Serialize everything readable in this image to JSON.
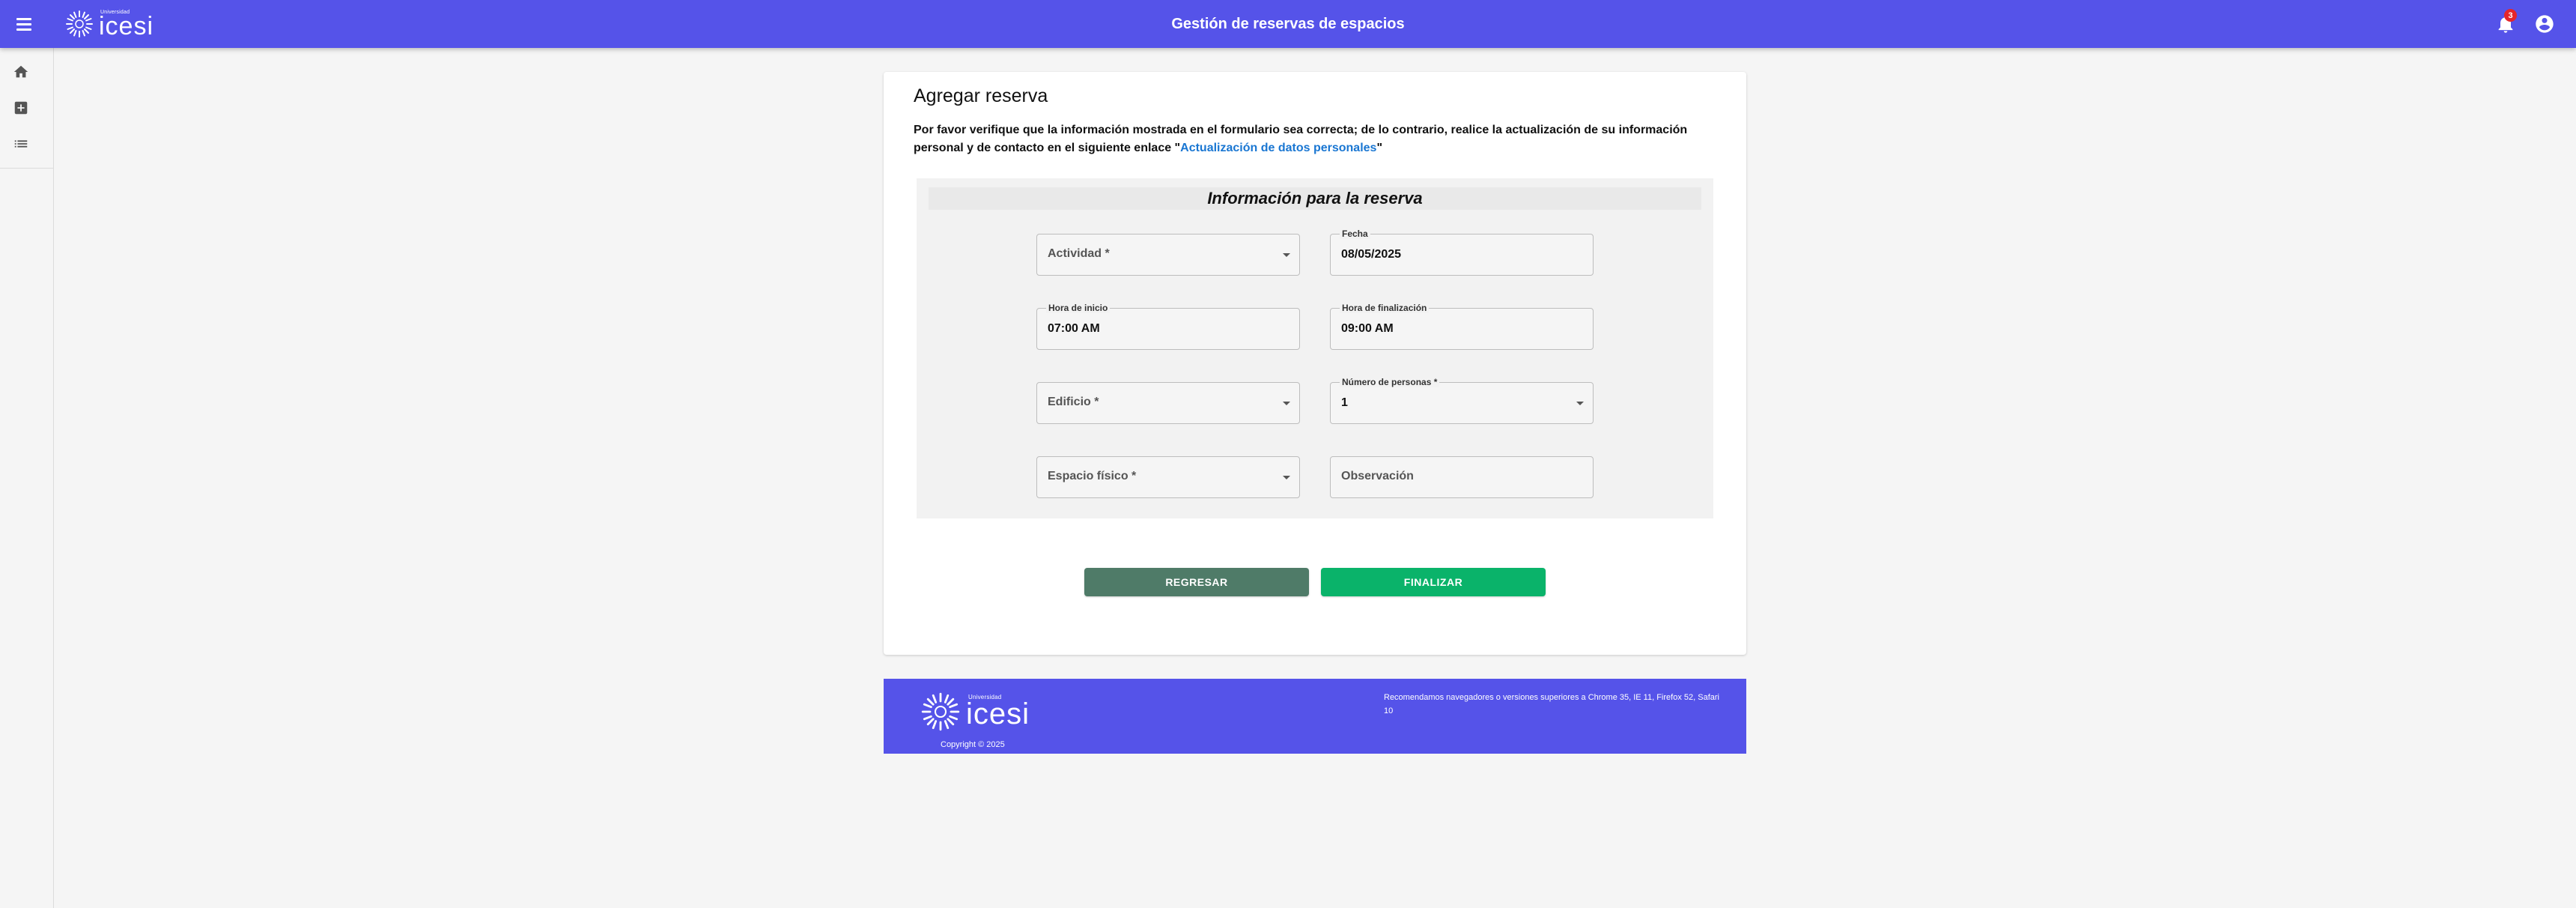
{
  "header": {
    "app_title": "Gestión de reservas de espacios",
    "logo_small": "Universidad",
    "logo_big": "icesi",
    "notification_count": "3",
    "icons": [
      "menu-icon",
      "bell-icon",
      "account-circle-icon"
    ],
    "color": "#5553e9"
  },
  "sidebar": {
    "items": [
      {
        "icon": "home-icon"
      },
      {
        "icon": "add-box-icon"
      },
      {
        "icon": "list-icon"
      }
    ]
  },
  "main": {
    "title": "Agregar reserva",
    "notice_text": "Por favor verifique que la información mostrada en el formulario sea correcta; de lo contrario, realice la actualización de su información personal y de contacto en el siguiente enlace \"",
    "notice_link": "Actualización de datos personales",
    "notice_end": "\"",
    "section_title": "Información para la reserva",
    "fields": {
      "actividad": {
        "placeholder": "Actividad *",
        "value": ""
      },
      "fecha": {
        "label": "Fecha",
        "value": "08/05/2025"
      },
      "hora_inicio": {
        "label": "Hora de inicio",
        "value": "07:00 AM"
      },
      "hora_fin": {
        "label": "Hora de finalización",
        "value": "09:00 AM"
      },
      "edificio": {
        "placeholder": "Edificio *",
        "value": ""
      },
      "numero_personas": {
        "label": "Número de personas *",
        "value": "1"
      },
      "espacio_fisico": {
        "placeholder": "Espacio físico *",
        "value": ""
      },
      "observacion": {
        "placeholder": "Observación",
        "value": ""
      }
    },
    "buttons": {
      "back": "REGRESAR",
      "finish": "FINALIZAR"
    },
    "colors": {
      "back": "#4f7b68",
      "finish": "#0ab36a",
      "link": "#1976d2"
    }
  },
  "footer": {
    "logo_small": "Universidad",
    "logo_big": "icesi",
    "copyright": "Copyright © 2025",
    "browsers": "Recomendamos navegadores o versiones superiores a Chrome 35, IE 11, Firefox 52, Safari 10"
  }
}
